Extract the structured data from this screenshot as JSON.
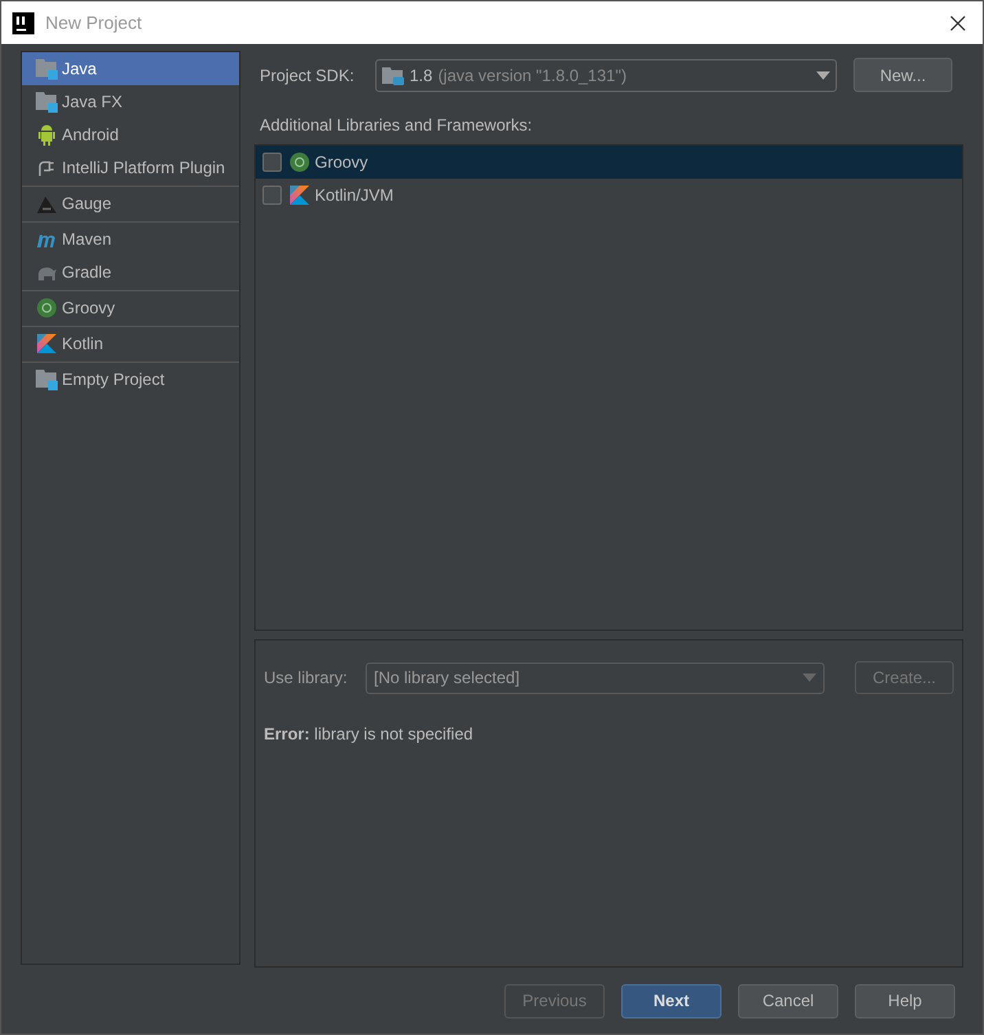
{
  "window": {
    "title": "New Project"
  },
  "sidebar": {
    "groups": [
      [
        {
          "label": "Java",
          "kind": "folder",
          "selected": true
        },
        {
          "label": "Java FX",
          "kind": "folder",
          "selected": false
        },
        {
          "label": "Android",
          "kind": "android",
          "selected": false
        },
        {
          "label": "IntelliJ Platform Plugin",
          "kind": "plug",
          "selected": false
        }
      ],
      [
        {
          "label": "Gauge",
          "kind": "gauge",
          "selected": false
        }
      ],
      [
        {
          "label": "Maven",
          "kind": "maven",
          "selected": false
        },
        {
          "label": "Gradle",
          "kind": "gradle",
          "selected": false
        }
      ],
      [
        {
          "label": "Groovy",
          "kind": "groovy",
          "selected": false
        }
      ],
      [
        {
          "label": "Kotlin",
          "kind": "kotlin",
          "selected": false
        }
      ],
      [
        {
          "label": "Empty Project",
          "kind": "folder",
          "selected": false
        }
      ]
    ]
  },
  "sdk": {
    "label": "Project SDK:",
    "version": "1.8",
    "detail": "(java version \"1.8.0_131\")",
    "button": "New..."
  },
  "frameworks": {
    "label": "Additional Libraries and Frameworks:",
    "items": [
      {
        "label": "Groovy",
        "kind": "groovy",
        "checked": false,
        "selected": true
      },
      {
        "label": "Kotlin/JVM",
        "kind": "kotlin",
        "checked": false,
        "selected": false
      }
    ]
  },
  "library": {
    "label": "Use library:",
    "value": "[No library selected]",
    "button": "Create...",
    "button_disabled": true,
    "error": "**Error:** library is not specified"
  },
  "buttons": [
    {
      "label": "Previous",
      "kind": "plain",
      "disabled": true
    },
    {
      "label": "Next",
      "kind": "default",
      "disabled": false
    },
    {
      "label": "Cancel",
      "kind": "plain",
      "disabled": false
    },
    {
      "label": "Help",
      "kind": "plain",
      "disabled": false
    }
  ]
}
